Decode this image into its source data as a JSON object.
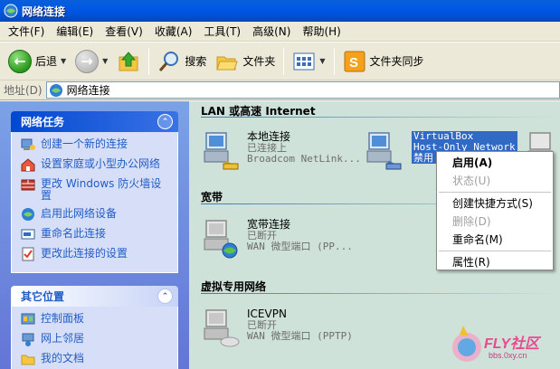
{
  "window": {
    "title": "网络连接"
  },
  "menu": [
    "文件(F)",
    "编辑(E)",
    "查看(V)",
    "收藏(A)",
    "工具(T)",
    "高级(N)",
    "帮助(H)"
  ],
  "toolbar": {
    "back": "后退",
    "search": "搜索",
    "folders": "文件夹",
    "sync": "文件夹同步"
  },
  "address": {
    "label": "地址(D)",
    "value": "网络连接"
  },
  "sidebar": {
    "network_tasks": {
      "title": "网络任务",
      "items": [
        "创建一个新的连接",
        "设置家庭或小型办公网络",
        "更改 Windows 防火墙设置",
        "启用此网络设备",
        "重命名此连接",
        "更改此连接的设置"
      ]
    },
    "other_places": {
      "title": "其它位置",
      "items": [
        "控制面板",
        "网上邻居",
        "我的文档"
      ]
    }
  },
  "groups": {
    "lan": {
      "title": "LAN 或高速 Internet",
      "local": {
        "name": "本地连接",
        "status": "已连接上",
        "device": "Broadcom NetLink..."
      },
      "vbox": {
        "line1": "VirtualBox",
        "line2": "Host-Only Network",
        "line3": "禁用"
      }
    },
    "broadband": {
      "title": "宽带",
      "conn": {
        "name": "宽带连接",
        "status": "已断开",
        "device": "WAN 微型端口 (PP..."
      }
    },
    "vpn": {
      "title": "虚拟专用网络",
      "conn": {
        "name": "ICEVPN",
        "status": "已断开",
        "device": "WAN 微型端口 (PPTP)"
      }
    }
  },
  "context_menu": {
    "enable": "启用(A)",
    "status": "状态(U)",
    "shortcut": "创建快捷方式(S)",
    "delete": "删除(D)",
    "rename": "重命名(M)",
    "properties": "属性(R)"
  },
  "watermark": {
    "text": "FLY社区",
    "url": "bbs.0xy.cn"
  },
  "colors": {
    "titlebar": "#0058e6",
    "sidebar": "#6f8fe0",
    "content": "#cfe2d9",
    "selection": "#316ac5",
    "link": "#215dc6"
  }
}
